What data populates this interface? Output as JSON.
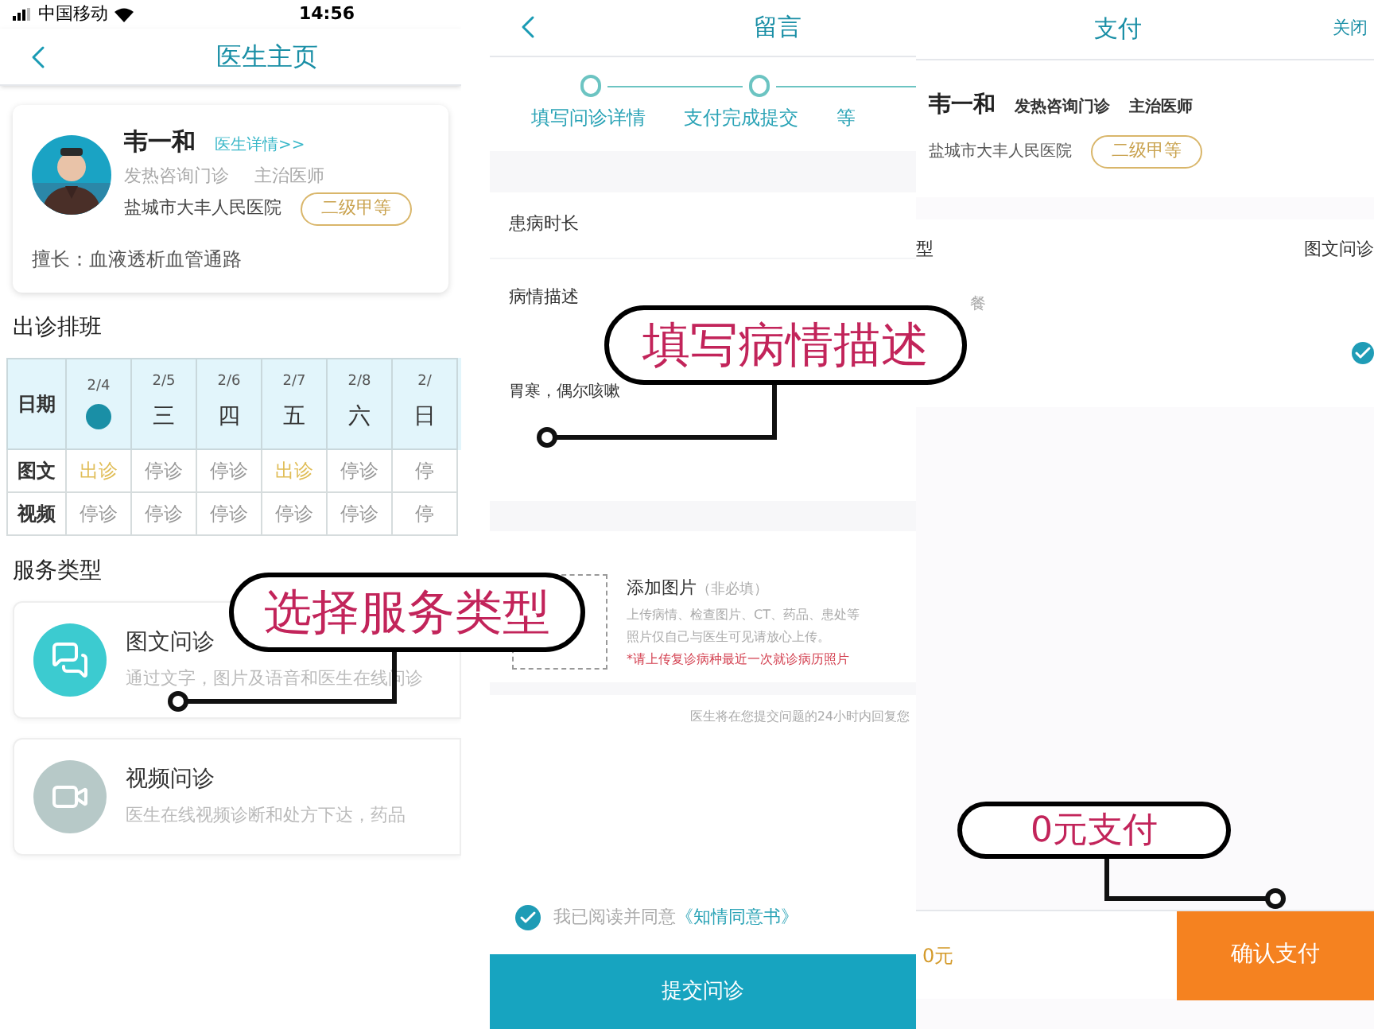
{
  "doctor_page": {
    "status_bar": {
      "carrier": "中国移动",
      "time": "14:56"
    },
    "title": "医生主页",
    "doctor": {
      "name": "韦一和",
      "detail_link": "医生详情>>",
      "department": "发热咨询门诊",
      "position": "主治医师",
      "hospital": "盐城市大丰人民医院",
      "grade": "二级甲等",
      "specialty": "擅长：血液透析血管通路"
    },
    "schedule": {
      "title": "出诊排班",
      "corner": "日期",
      "columns": [
        {
          "date": "2/4",
          "today": true
        },
        {
          "date": "2/5",
          "day": "三",
          "today": false
        },
        {
          "date": "2/6",
          "day": "四",
          "today": false
        },
        {
          "date": "2/7",
          "day": "五",
          "today": false
        },
        {
          "date": "2/8",
          "day": "六",
          "today": false
        },
        {
          "date": "2/",
          "day": "日",
          "today": false
        }
      ],
      "rows": [
        {
          "label": "图文",
          "cells": [
            {
              "text": "出诊",
              "open": true
            },
            {
              "text": "停诊",
              "open": false
            },
            {
              "text": "停诊",
              "open": false
            },
            {
              "text": "出诊",
              "open": true
            },
            {
              "text": "停诊",
              "open": false
            },
            {
              "text": "停",
              "open": false
            }
          ]
        },
        {
          "label": "视频",
          "cells": [
            {
              "text": "停诊",
              "open": false
            },
            {
              "text": "停诊",
              "open": false
            },
            {
              "text": "停诊",
              "open": false
            },
            {
              "text": "停诊",
              "open": false
            },
            {
              "text": "停诊",
              "open": false
            },
            {
              "text": "停",
              "open": false
            }
          ]
        }
      ]
    },
    "services_title": "服务类型",
    "services": [
      {
        "kind": "chat",
        "name": "图文问诊",
        "description": "通过文字，图片及语音和医生在线问诊"
      },
      {
        "kind": "video",
        "name": "视频问诊",
        "description": "医生在线视频诊断和处方下达，药品"
      }
    ]
  },
  "message_page": {
    "title": "留言",
    "steps": [
      {
        "label": "填写问诊详情"
      },
      {
        "label": "支付完成提交"
      },
      {
        "label": "等"
      }
    ],
    "fields": [
      {
        "label": "患病时长"
      },
      {
        "label": "病情描述",
        "value": "胃寒，偶尔咳嗽"
      }
    ],
    "upload": {
      "title": "添加图片",
      "note": "（非必填）",
      "lines": [
        "上传病情、检查图片、CT、药品、患处等",
        "照片仅自己与医生可见请放心上传。"
      ],
      "warning": "*请上传复诊病种最近一次就诊病历照片"
    },
    "reply_notice": "医生将在您提交问题的24小时内回复您",
    "agreement": {
      "checked": true,
      "text": "我已阅读并同意",
      "link": "《知情同意书》"
    },
    "submit": "提交问诊"
  },
  "payment_page": {
    "title": "支付",
    "close": "关闭",
    "doctor": {
      "name": "韦一和",
      "department": "发热咨询门诊",
      "position": "主治医师",
      "hospital": "盐城市大丰人民医院",
      "grade": "二级甲等"
    },
    "service_row": {
      "label": "型",
      "value": "图文问诊"
    },
    "package_label": "餐",
    "package_checked": true,
    "total": "0元",
    "confirm": "确认支付"
  },
  "callouts": [
    {
      "text": "选择服务类型"
    },
    {
      "text": "填写病情描述"
    },
    {
      "text": "0元支付"
    }
  ]
}
